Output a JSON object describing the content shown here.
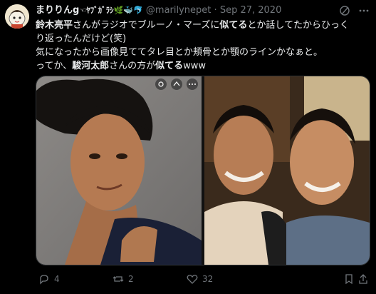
{
  "tweet": {
    "display_name": "まりりんg",
    "name_emojis": "☜ﾔﾌﾞｶﾞﾗｼ🌿🐳🐬",
    "handle": "@marilynepet",
    "separator": "·",
    "date": "Sep 27, 2020",
    "body": {
      "l1_a": "鈴木亮平",
      "l1_b": "さんがラジオでブルーノ・マーズに",
      "l1_c": "似てる",
      "l1_d": "とか話してたからひっく",
      "l2": "り返ったんだけど(笑)",
      "l3": "気になったから画像見ててタレ目とか頬骨とか顎のラインかなぁと。",
      "l4_a": "ってか、",
      "l4_b": "駿河太郎",
      "l4_c": "さんの方が",
      "l4_d": "似てる",
      "l4_e": "www"
    },
    "actions": {
      "replies": "4",
      "retweets": "2",
      "likes": "32"
    }
  },
  "colors": {
    "background": "#000000",
    "text": "#e7e9ea",
    "muted": "#71767b",
    "border": "#2f3336"
  },
  "icons": [
    "avatar-image",
    "grok-icon",
    "more-icon",
    "reply-icon",
    "retweet-icon",
    "like-icon",
    "bookmark-icon",
    "share-icon"
  ]
}
